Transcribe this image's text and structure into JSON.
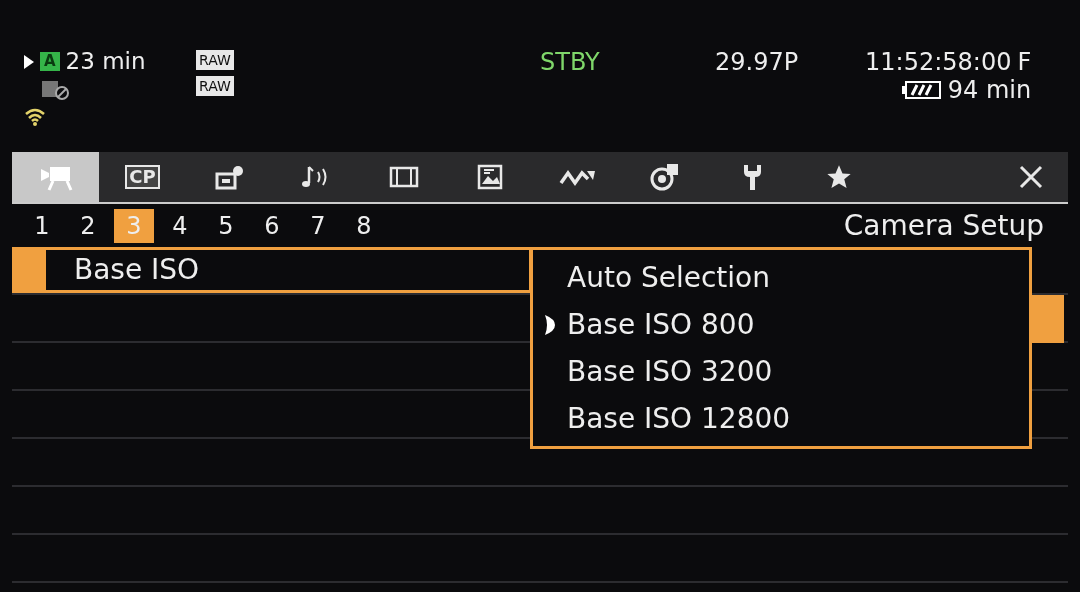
{
  "status": {
    "media_a": "A",
    "remaining": "23 min",
    "raw_formats": [
      "RAW",
      "RAW"
    ],
    "mode": "STBY",
    "frame_rate": "29.97P",
    "timecode": "11:52:58:00",
    "timecode_flag": "F",
    "battery": "94 min"
  },
  "tabs": [
    {
      "kind": "camera",
      "selected": true
    },
    {
      "kind": "label",
      "label": "CP",
      "selected": false
    },
    {
      "kind": "camera-gear",
      "selected": false
    },
    {
      "kind": "audio",
      "selected": false
    },
    {
      "kind": "film",
      "selected": false
    },
    {
      "kind": "display",
      "selected": false
    },
    {
      "kind": "wave",
      "selected": false
    },
    {
      "kind": "record",
      "selected": false
    },
    {
      "kind": "wrench",
      "selected": false
    },
    {
      "kind": "star",
      "selected": false
    },
    {
      "kind": "close",
      "selected": false
    }
  ],
  "pages": [
    {
      "label": "1",
      "selected": false
    },
    {
      "label": "2",
      "selected": false
    },
    {
      "label": "3",
      "selected": true
    },
    {
      "label": "4",
      "selected": false
    },
    {
      "label": "5",
      "selected": false
    },
    {
      "label": "6",
      "selected": false
    },
    {
      "label": "7",
      "selected": false
    },
    {
      "label": "8",
      "selected": false
    }
  ],
  "menu_title": "Camera Setup",
  "menu_items": [
    {
      "label": "Base ISO",
      "selected": true
    }
  ],
  "options": [
    {
      "label": "Auto Selection",
      "current": false
    },
    {
      "label": "Base ISO 800",
      "current": true
    },
    {
      "label": "Base ISO 3200",
      "current": false
    },
    {
      "label": "Base ISO 12800",
      "current": false
    }
  ]
}
